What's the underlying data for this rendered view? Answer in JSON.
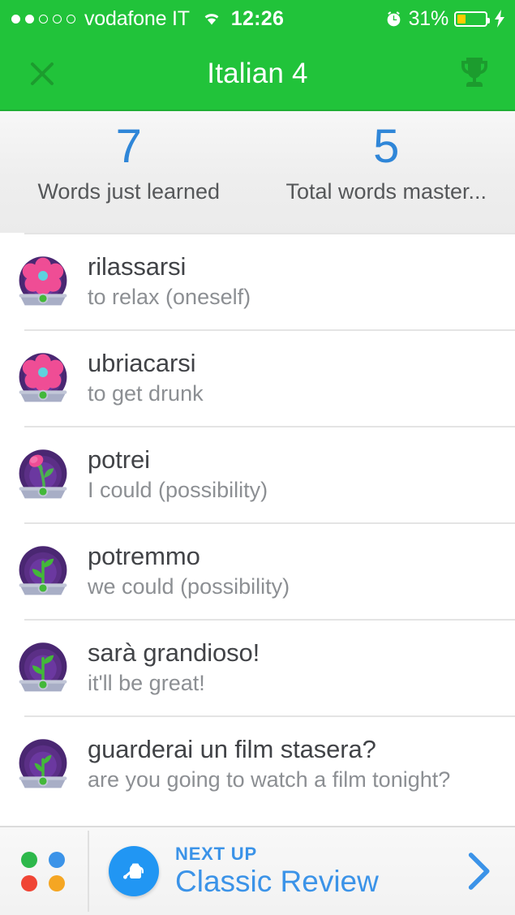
{
  "status_bar": {
    "signal_dots_filled": 2,
    "signal_dots_total": 5,
    "carrier": "vodafone IT",
    "wifi_icon": "wifi-icon",
    "time": "12:26",
    "alarm_icon": "alarm-clock-icon",
    "battery_percent": "31%",
    "battery_level": 31,
    "battery_color": "#ffcc00",
    "charging_icon": "lightning-bolt-icon",
    "background_color": "#21c33a"
  },
  "nav_bar": {
    "close_icon": "close-x-icon",
    "title": "Italian 4",
    "trophy_icon": "trophy-icon",
    "background_color": "#21c33a"
  },
  "stats": {
    "accent_color": "#2f86d8",
    "items": [
      {
        "value": "7",
        "label": "Words just learned"
      },
      {
        "value": "5",
        "label": "Total words master..."
      }
    ]
  },
  "word_list": {
    "rows": [
      {
        "icon": "flower-bloom-icon",
        "stage": "bloom",
        "term": "rilassarsi",
        "definition": "to relax (oneself)"
      },
      {
        "icon": "flower-bloom-icon",
        "stage": "bloom",
        "term": "ubriacarsi",
        "definition": "to get drunk"
      },
      {
        "icon": "flower-bud-icon",
        "stage": "bud",
        "term": "potrei",
        "definition": "I could (possibility)"
      },
      {
        "icon": "sprout-icon",
        "stage": "sprout",
        "term": "potremmo",
        "definition": "we could (possibility)"
      },
      {
        "icon": "sprout-icon",
        "stage": "sprout",
        "term": "sarà grandioso!",
        "definition": "it'll be great!"
      },
      {
        "icon": "sprout-icon",
        "stage": "sprout",
        "term": "guarderai un film stasera?",
        "definition": "are you going to watch a film tonight?"
      }
    ]
  },
  "bottom_bar": {
    "quad_dots": [
      "#2db84b",
      "#3b93e8",
      "#f04535",
      "#f5a623"
    ],
    "watering_can_icon": "watering-can-icon",
    "kicker": "NEXT UP",
    "title": "Classic Review",
    "chevron_icon": "chevron-right-icon",
    "accent_color": "#3b93e8"
  }
}
